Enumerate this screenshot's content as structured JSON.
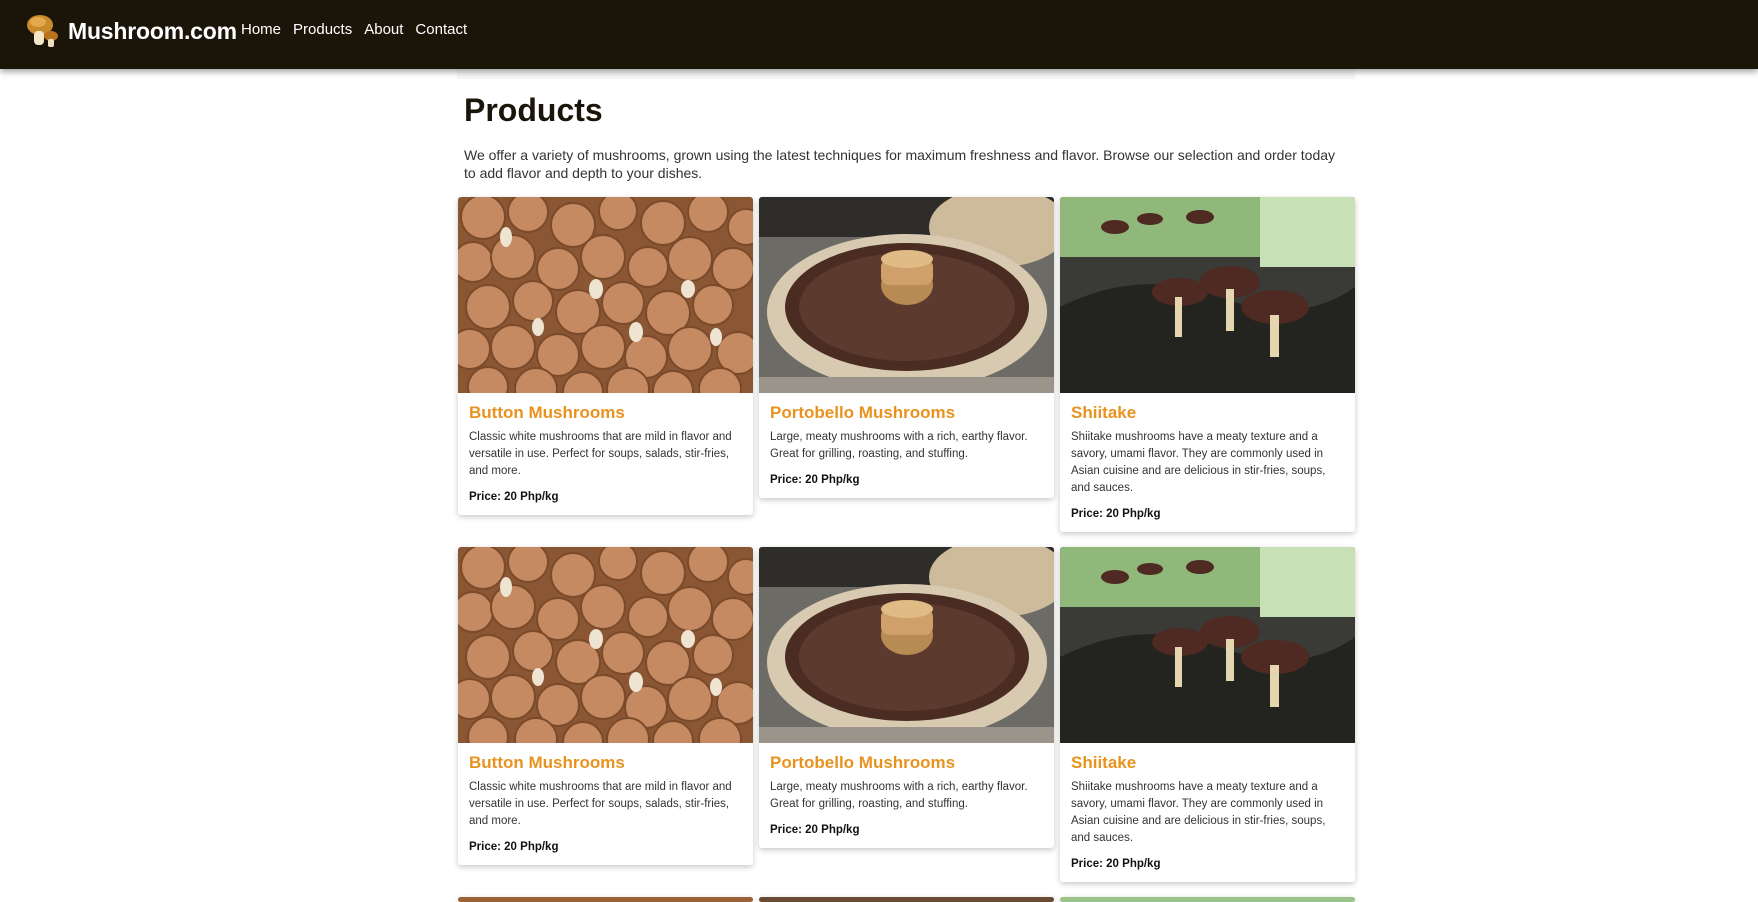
{
  "header": {
    "brand": "Mushroom.com",
    "nav": [
      "Home",
      "Products",
      "About",
      "Contact"
    ]
  },
  "main": {
    "title": "Products",
    "intro": "We offer a variety of mushrooms, grown using the latest techniques for maximum freshness and flavor. Browse our selection and order today to add flavor and depth to your dishes."
  },
  "products": [
    {
      "name": "Button Mushrooms",
      "desc": "Classic white mushrooms that are mild in flavor and versatile in use. Perfect for soups, salads, stir-fries, and more.",
      "price": "Price: 20 Php/kg",
      "image": "button-mushroom-image"
    },
    {
      "name": "Portobello Mushrooms",
      "desc": "Large, meaty mushrooms with a rich, earthy flavor. Great for grilling, roasting, and stuffing.",
      "price": "Price: 20 Php/kg",
      "image": "portobello-mushroom-image"
    },
    {
      "name": "Shiitake",
      "desc": "Shiitake mushrooms have a meaty texture and a savory, umami flavor. They are commonly used in Asian cuisine and are delicious in stir-fries, soups, and sauces.",
      "price": "Price: 20 Php/kg",
      "image": "shiitake-mushroom-image"
    },
    {
      "name": "Button Mushrooms",
      "desc": "Classic white mushrooms that are mild in flavor and versatile in use. Perfect for soups, salads, stir-fries, and more.",
      "price": "Price: 20 Php/kg",
      "image": "button-mushroom-image"
    },
    {
      "name": "Portobello Mushrooms",
      "desc": "Large, meaty mushrooms with a rich, earthy flavor. Great for grilling, roasting, and stuffing.",
      "price": "Price: 20 Php/kg",
      "image": "portobello-mushroom-image"
    },
    {
      "name": "Shiitake",
      "desc": "Shiitake mushrooms have a meaty texture and a savory, umami flavor. They are commonly used in Asian cuisine and are delicious in stir-fries, soups, and sauces.",
      "price": "Price: 20 Php/kg",
      "image": "shiitake-mushroom-image"
    }
  ],
  "colors": {
    "header_bg": "#1b1409",
    "accent": "#e8921f"
  }
}
